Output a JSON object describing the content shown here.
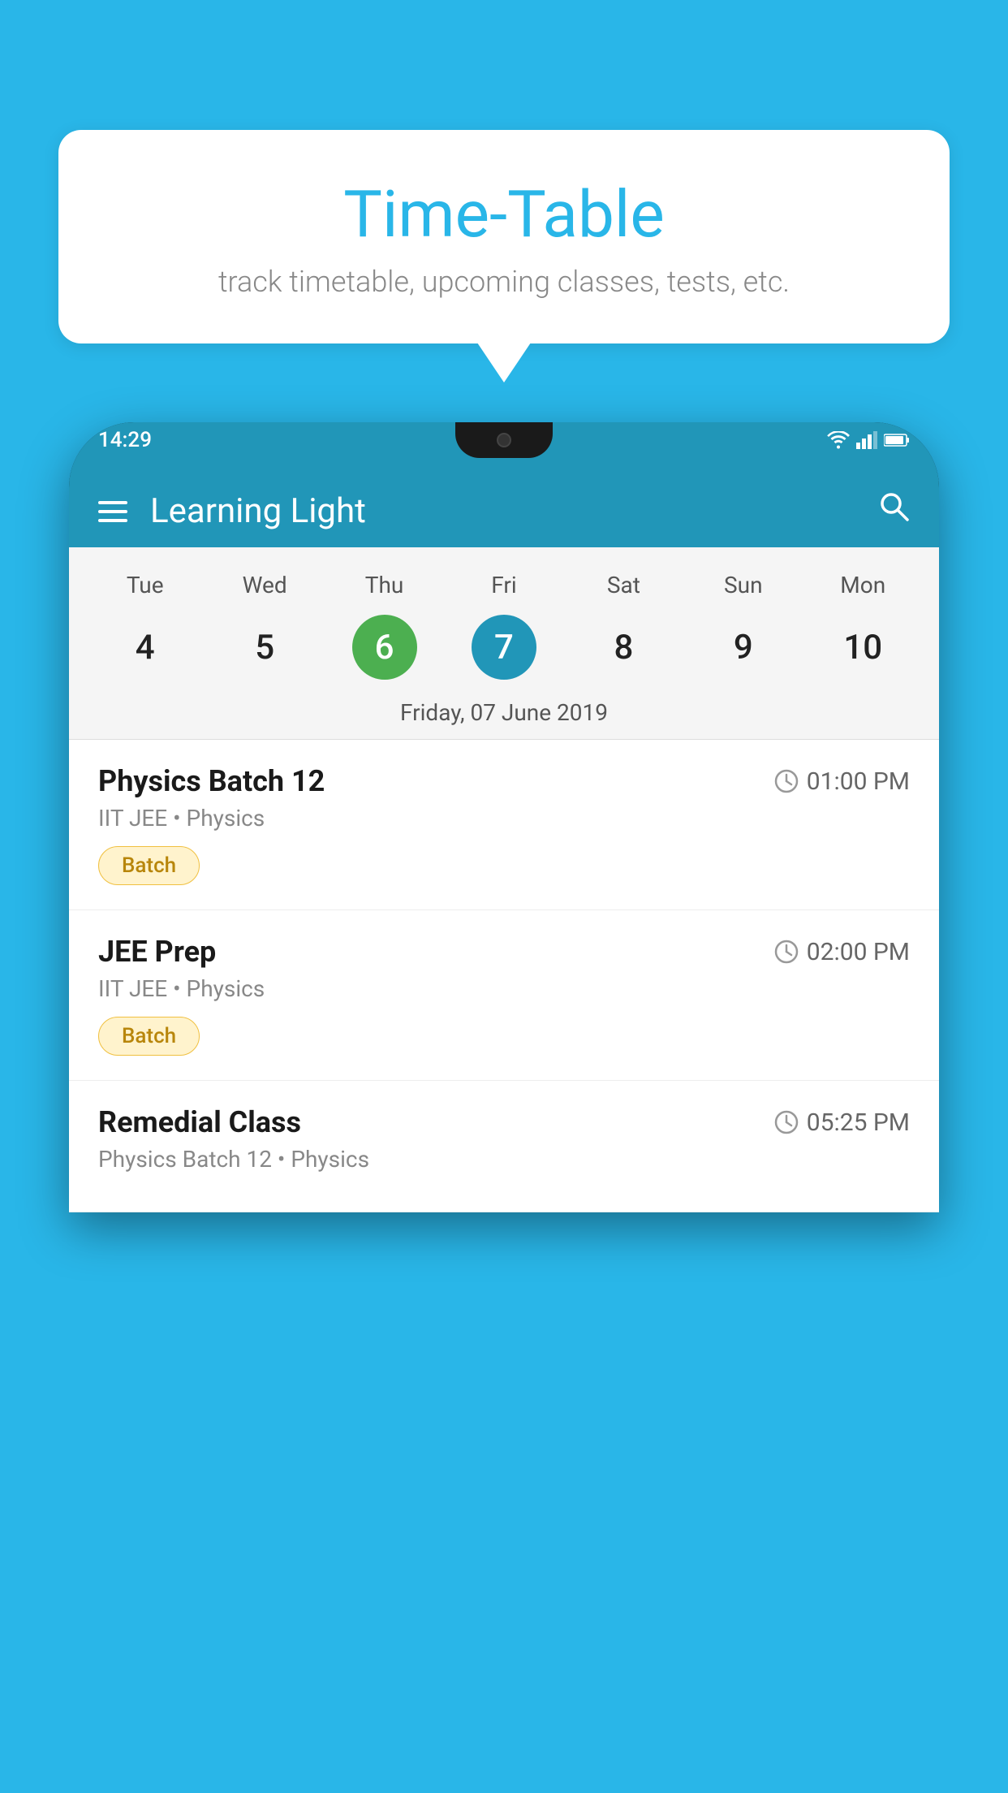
{
  "background_color": "#29b6e8",
  "speech_bubble": {
    "title": "Time-Table",
    "subtitle": "track timetable, upcoming classes, tests, etc."
  },
  "status_bar": {
    "time": "14:29",
    "icons": [
      "wifi",
      "signal",
      "battery"
    ]
  },
  "app_bar": {
    "title": "Learning Light",
    "hamburger_aria": "menu",
    "search_aria": "search"
  },
  "calendar": {
    "days": [
      {
        "label": "Tue",
        "number": "4"
      },
      {
        "label": "Wed",
        "number": "5"
      },
      {
        "label": "Thu",
        "number": "6",
        "state": "today"
      },
      {
        "label": "Fri",
        "number": "7",
        "state": "selected"
      },
      {
        "label": "Sat",
        "number": "8"
      },
      {
        "label": "Sun",
        "number": "9"
      },
      {
        "label": "Mon",
        "number": "10"
      }
    ],
    "selected_date_label": "Friday, 07 June 2019"
  },
  "schedule": {
    "items": [
      {
        "title": "Physics Batch 12",
        "time": "01:00 PM",
        "subtitle": "IIT JEE • Physics",
        "badge": "Batch"
      },
      {
        "title": "JEE Prep",
        "time": "02:00 PM",
        "subtitle": "IIT JEE • Physics",
        "badge": "Batch"
      },
      {
        "title": "Remedial Class",
        "time": "05:25 PM",
        "subtitle": "Physics Batch 12 • Physics",
        "badge": null
      }
    ]
  }
}
